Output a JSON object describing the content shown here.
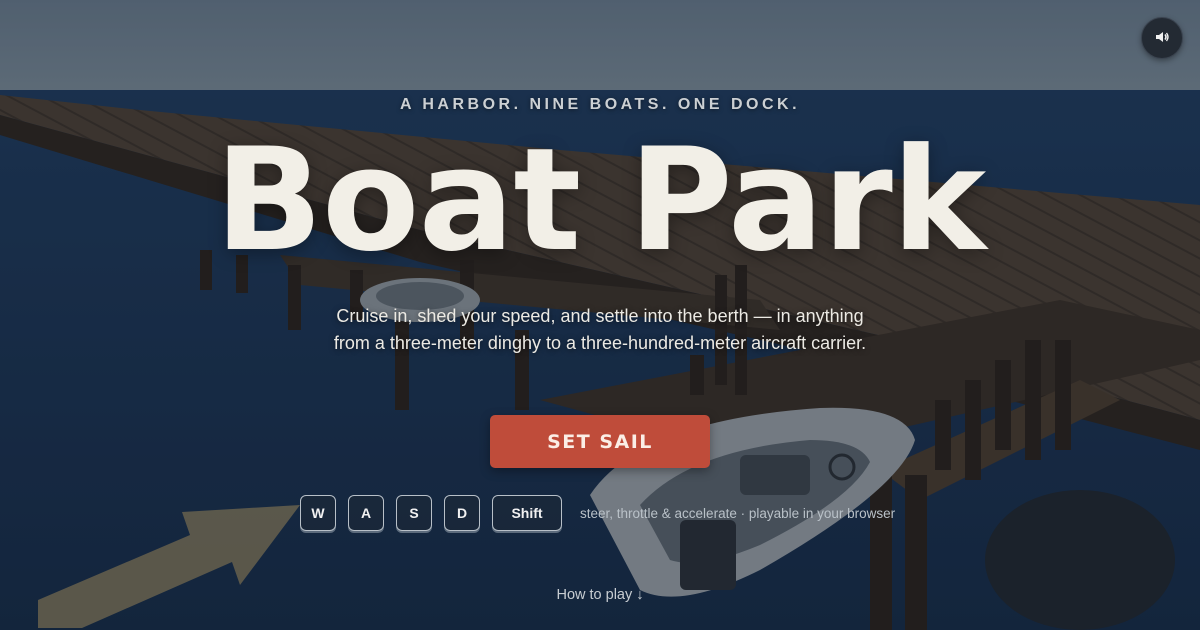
{
  "hero": {
    "tagline": "A HARBOR. NINE BOATS. ONE DOCK.",
    "title": "Boat Park",
    "subtitle": "Cruise in, shed your speed, and settle into the berth — in anything from a three-meter dinghy to a three-hundred-meter aircraft carrier.",
    "cta_label": "SET SAIL"
  },
  "controls": {
    "keys": [
      "W",
      "A",
      "S",
      "D",
      "Shift"
    ],
    "hint": "steer, throttle & accelerate · playable in your browser"
  },
  "footer": {
    "how_to_play": "How to play ↓"
  },
  "icons": {
    "sound": "speaker-icon",
    "down": "arrow-down"
  },
  "colors": {
    "accent": "#bf4c3a",
    "title": "#f2efe7",
    "water": "#1b3556",
    "dock": "#4a3c30"
  }
}
